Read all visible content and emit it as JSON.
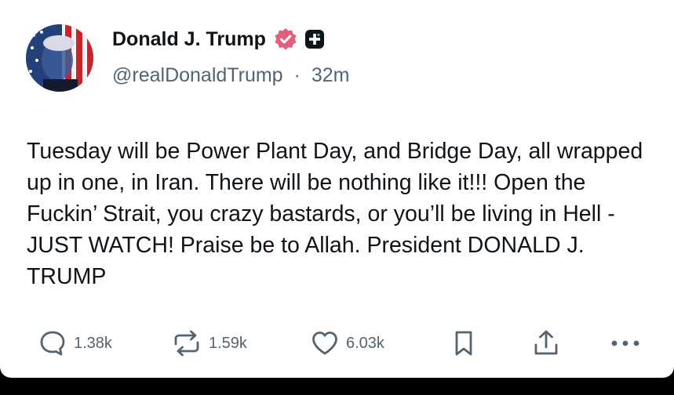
{
  "post": {
    "display_name": "Donald J. Trump",
    "handle": "@realDonaldTrump",
    "separator": "·",
    "time": "32m",
    "text": "Tuesday will be Power Plant Day, and Bridge Day, all wrapped up in one, in Iran. There will be nothing like it!!! Open the Fuckin’ Strait, you crazy bastards, or you’ll be living in Hell - JUST WATCH! Praise be to Allah. President DONALD J. TRUMP"
  },
  "badges": {
    "verified_color": "#e0607c",
    "plus_color": "#0f1419"
  },
  "actions": {
    "replies": "1.38k",
    "reposts": "1.59k",
    "likes": "6.03k"
  },
  "icons": [
    "reply-icon",
    "repost-icon",
    "heart-icon",
    "bookmark-icon",
    "share-icon",
    "more-icon"
  ],
  "colors": {
    "text_primary": "#0f1419",
    "text_secondary": "#536471",
    "background": "#ffffff"
  }
}
